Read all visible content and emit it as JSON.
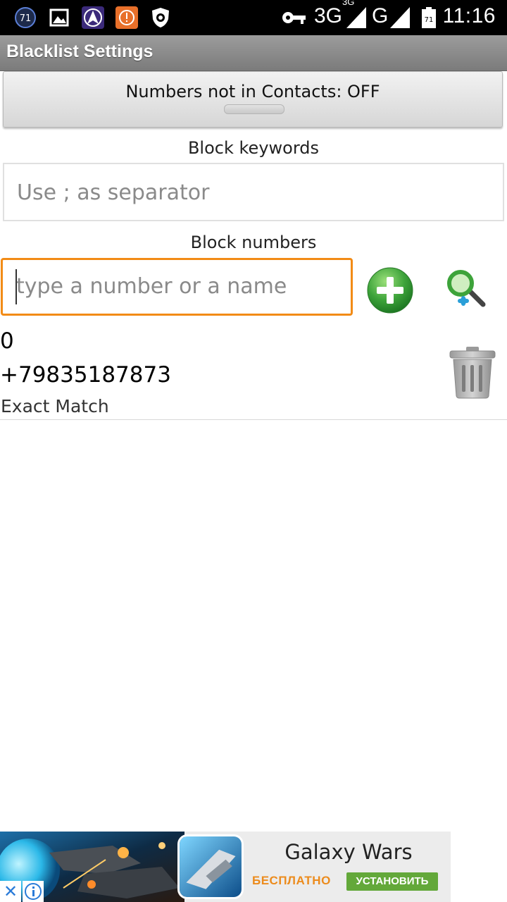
{
  "status_bar": {
    "notification_badge": "71",
    "network_primary": "3G",
    "network_primary_sup": "3G",
    "network_secondary": "G",
    "battery_badge": "71",
    "time": "11:16",
    "icons": [
      "counter-badge-icon",
      "gallery-icon",
      "navigation-app-icon",
      "warning-app-icon",
      "antivirus-icon",
      "vpn-key-icon",
      "signal-icon",
      "battery-icon"
    ]
  },
  "app_bar": {
    "title": "Blacklist Settings"
  },
  "contacts_toggle": {
    "label": "Numbers not in Contacts: OFF",
    "state": "OFF"
  },
  "keywords": {
    "label": "Block keywords",
    "placeholder": "Use ; as separator",
    "value": ""
  },
  "numbers": {
    "label": "Block numbers",
    "placeholder": "type a number or a name",
    "value": "",
    "add_icon": "add-circle-icon",
    "search_icon": "contact-search-icon"
  },
  "blocked_entries": [
    {
      "index": "0",
      "number": "+79835187873",
      "match_type": "Exact Match",
      "delete_icon": "trash-icon"
    }
  ],
  "ad": {
    "title": "Galaxy Wars",
    "price": "БЕСПЛАТНО",
    "install_label": "УСТАНОВИТЬ",
    "close_glyph": "✕",
    "colors": {
      "price": "#ec8b1c",
      "install": "#63a83a",
      "close": "#2a7bd8"
    }
  },
  "colors": {
    "input_focus_border": "#f28b16",
    "title_bar": "#8a8a8a",
    "add_button": "#4caf50"
  }
}
